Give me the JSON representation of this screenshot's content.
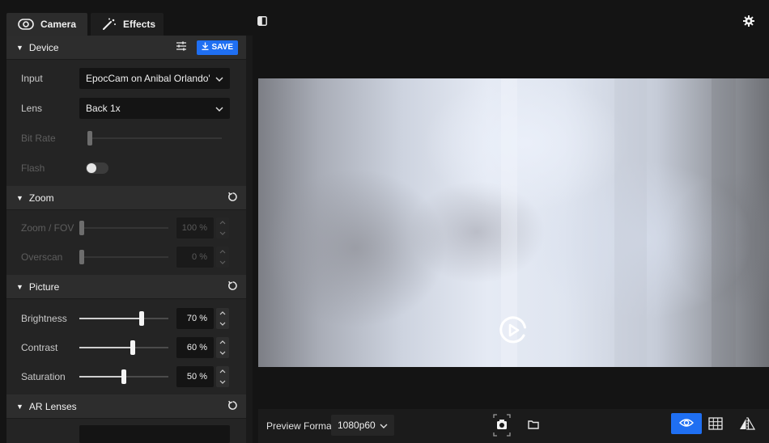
{
  "tabs": [
    {
      "label": "Camera",
      "icon": "camera-icon",
      "active": true
    },
    {
      "label": "Effects",
      "icon": "magic-wand-icon",
      "active": false
    }
  ],
  "device": {
    "title": "Device",
    "save_label": "SAVE",
    "input_label": "Input",
    "input_value": "EpocCam on Anibal Orlando's iF",
    "lens_label": "Lens",
    "lens_value": "Back 1x",
    "bitrate_label": "Bit Rate",
    "flash_label": "Flash",
    "flash_on": false
  },
  "zoom": {
    "title": "Zoom",
    "zoom_label": "Zoom / FOV",
    "zoom_value": "100 %",
    "overscan_label": "Overscan",
    "overscan_value": "0 %"
  },
  "picture": {
    "title": "Picture",
    "brightness_label": "Brightness",
    "brightness_value": "70 %",
    "brightness_level": 0.7,
    "contrast_label": "Contrast",
    "contrast_value": "60 %",
    "contrast_level": 0.6,
    "saturation_label": "Saturation",
    "saturation_value": "50 %",
    "saturation_level": 0.5
  },
  "ar_lenses": {
    "title": "AR Lenses"
  },
  "bottom_bar": {
    "preview_format_label": "Preview Format",
    "preview_format_value": "1080p60"
  },
  "colors": {
    "accent": "#1f6ff2",
    "panel": "#242424",
    "background": "#141414"
  }
}
